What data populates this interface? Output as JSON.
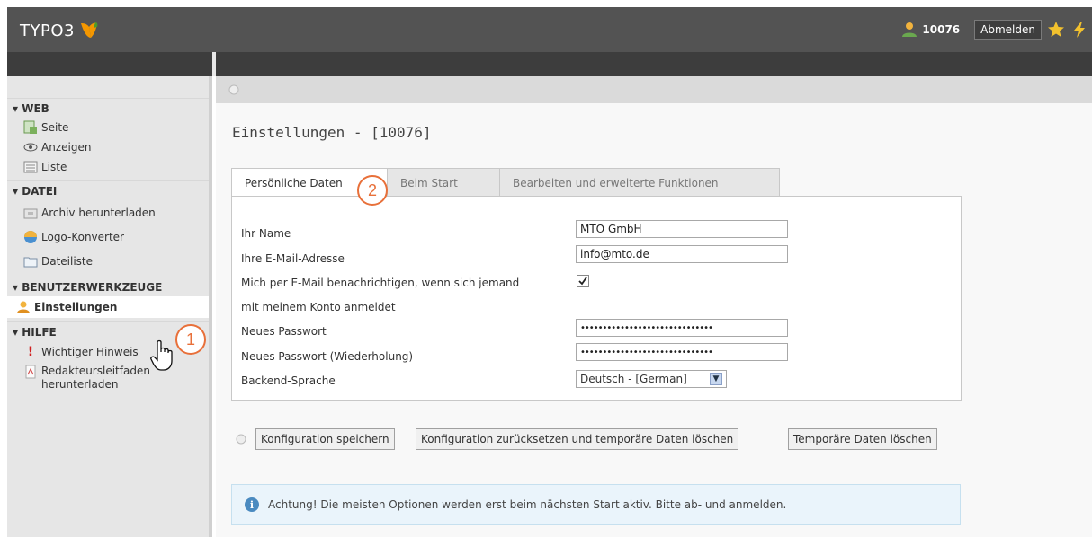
{
  "topbar": {
    "logo_text": "TYPO3",
    "user_id": "10076",
    "logout_label": "Abmelden"
  },
  "sidebar": {
    "groups": [
      {
        "title": "▾ WEB",
        "items": [
          {
            "label": "Seite",
            "icon": "page-icon"
          },
          {
            "label": "Anzeigen",
            "icon": "eye-icon"
          },
          {
            "label": "Liste",
            "icon": "list-icon"
          }
        ]
      },
      {
        "title": "▾ DATEI",
        "items": [
          {
            "label": "Archiv herunterladen",
            "icon": "archive-icon"
          },
          {
            "label": "Logo-Konverter",
            "icon": "logo-converter-icon"
          },
          {
            "label": "Dateiliste",
            "icon": "folder-icon"
          }
        ]
      },
      {
        "title": "▾ BENUTZERWERKZEUGE",
        "items": [
          {
            "label": "Einstellungen",
            "icon": "user-settings-icon",
            "active": true
          }
        ]
      },
      {
        "title": "▾ HILFE",
        "items": [
          {
            "label": "Wichtiger Hinweis",
            "icon": "exclamation-icon"
          },
          {
            "label": "Redakteursleitfaden herunterladen",
            "icon": "pdf-icon"
          }
        ]
      }
    ]
  },
  "page": {
    "title": "Einstellungen - [10076]",
    "tabs": [
      "Persönliche Daten",
      "Beim Start",
      "Bearbeiten und erweiterte Funktionen"
    ]
  },
  "form": {
    "name_label": "Ihr Name",
    "name_value": "MTO GmbH",
    "email_label": "Ihre E-Mail-Adresse",
    "email_value": "info@mto.de",
    "notify_label_1": "Mich per E-Mail benachrichtigen, wenn sich jemand",
    "notify_label_2": "mit meinem Konto anmeldet",
    "notify_checked": true,
    "pw_label": "Neues Passwort",
    "pw_value": "••••••••••••••••••••••••••••••",
    "pw2_label": "Neues Passwort (Wiederholung)",
    "pw2_value": "••••••••••••••••••••••••••••••",
    "lang_label": "Backend-Sprache",
    "lang_value": "Deutsch - [German]"
  },
  "buttons": {
    "save": "Konfiguration speichern",
    "reset": "Konfiguration zurücksetzen und temporäre Daten löschen",
    "clear": "Temporäre Daten löschen"
  },
  "notice": {
    "info_glyph": "i",
    "text": "Achtung! Die meisten Optionen werden erst beim nächsten Start aktiv. Bitte ab- und anmelden."
  },
  "callouts": {
    "one": "1",
    "two": "2"
  },
  "colors": {
    "accent": "#e8703a",
    "topbar": "#535353",
    "sidebar": "#e6e6e6",
    "typo3_orange": "#f49700"
  }
}
